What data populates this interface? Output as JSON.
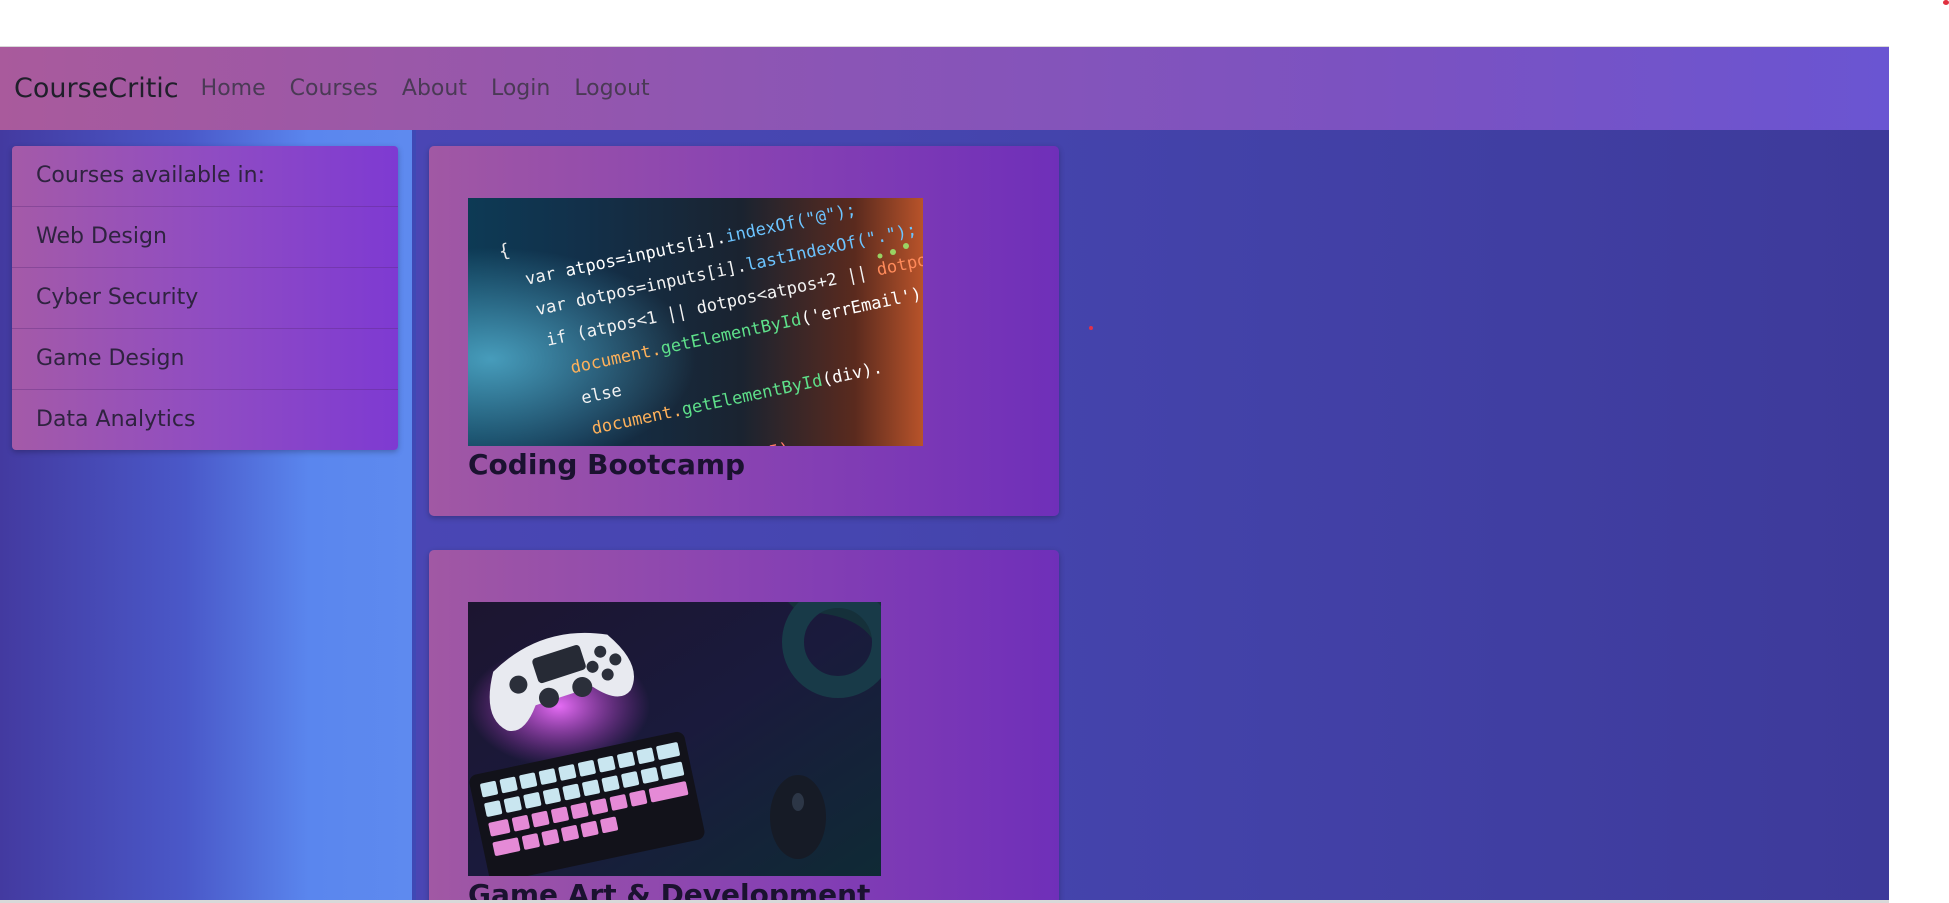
{
  "navbar": {
    "brand": "CourseCritic",
    "links": [
      "Home",
      "Courses",
      "About",
      "Login",
      "Logout"
    ]
  },
  "sidebar": {
    "items": [
      "Courses available in:",
      "Web Design",
      "Cyber Security",
      "Game Design",
      "Data Analytics"
    ]
  },
  "cards": [
    {
      "title": "Coding Bootcamp",
      "image": "code-editor-photo"
    },
    {
      "title": "Game Art & Development",
      "image": "gaming-gear-photo"
    }
  ],
  "colors": {
    "navbar_start": "#a95a9c",
    "navbar_end": "#6a55d2",
    "page_bg": "#4646b0",
    "card_start": "#a158a4",
    "card_end": "#6f2fb9"
  }
}
